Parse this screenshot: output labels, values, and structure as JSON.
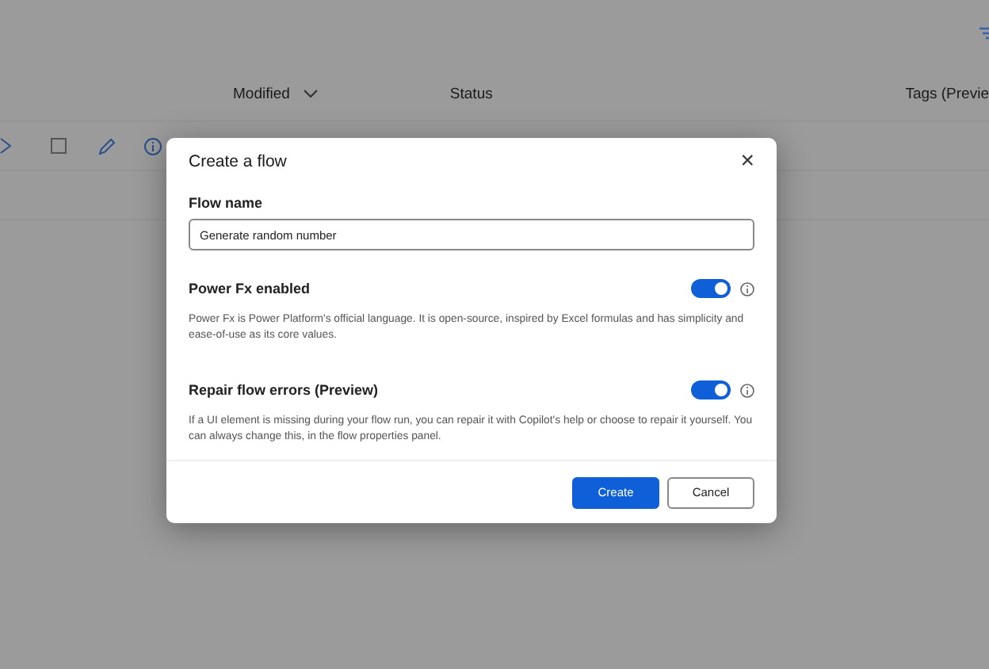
{
  "table": {
    "columns": [
      {
        "label": "Modified",
        "sortable": true
      },
      {
        "label": "Status",
        "sortable": false
      },
      {
        "label": "Tags (Previe",
        "sortable": false
      }
    ]
  },
  "dialog": {
    "title": "Create a flow",
    "close": "×",
    "name_field": {
      "label": "Flow name",
      "value": "Generate random number"
    },
    "settings": [
      {
        "label": "Power Fx enabled",
        "on": true,
        "description": "Power Fx is Power Platform's official language. It is open-source, inspired by Excel formulas and has simplicity and ease-of-use as its core values."
      },
      {
        "label": "Repair flow errors (Preview)",
        "on": true,
        "description": "If a UI element is missing during your flow run, you can repair it with Copilot's help or choose to repair it yourself. You can always change this, in the flow properties panel."
      }
    ],
    "buttons": [
      {
        "label": "Create",
        "kind": "primary"
      },
      {
        "label": "Cancel",
        "kind": "secondary"
      }
    ]
  }
}
